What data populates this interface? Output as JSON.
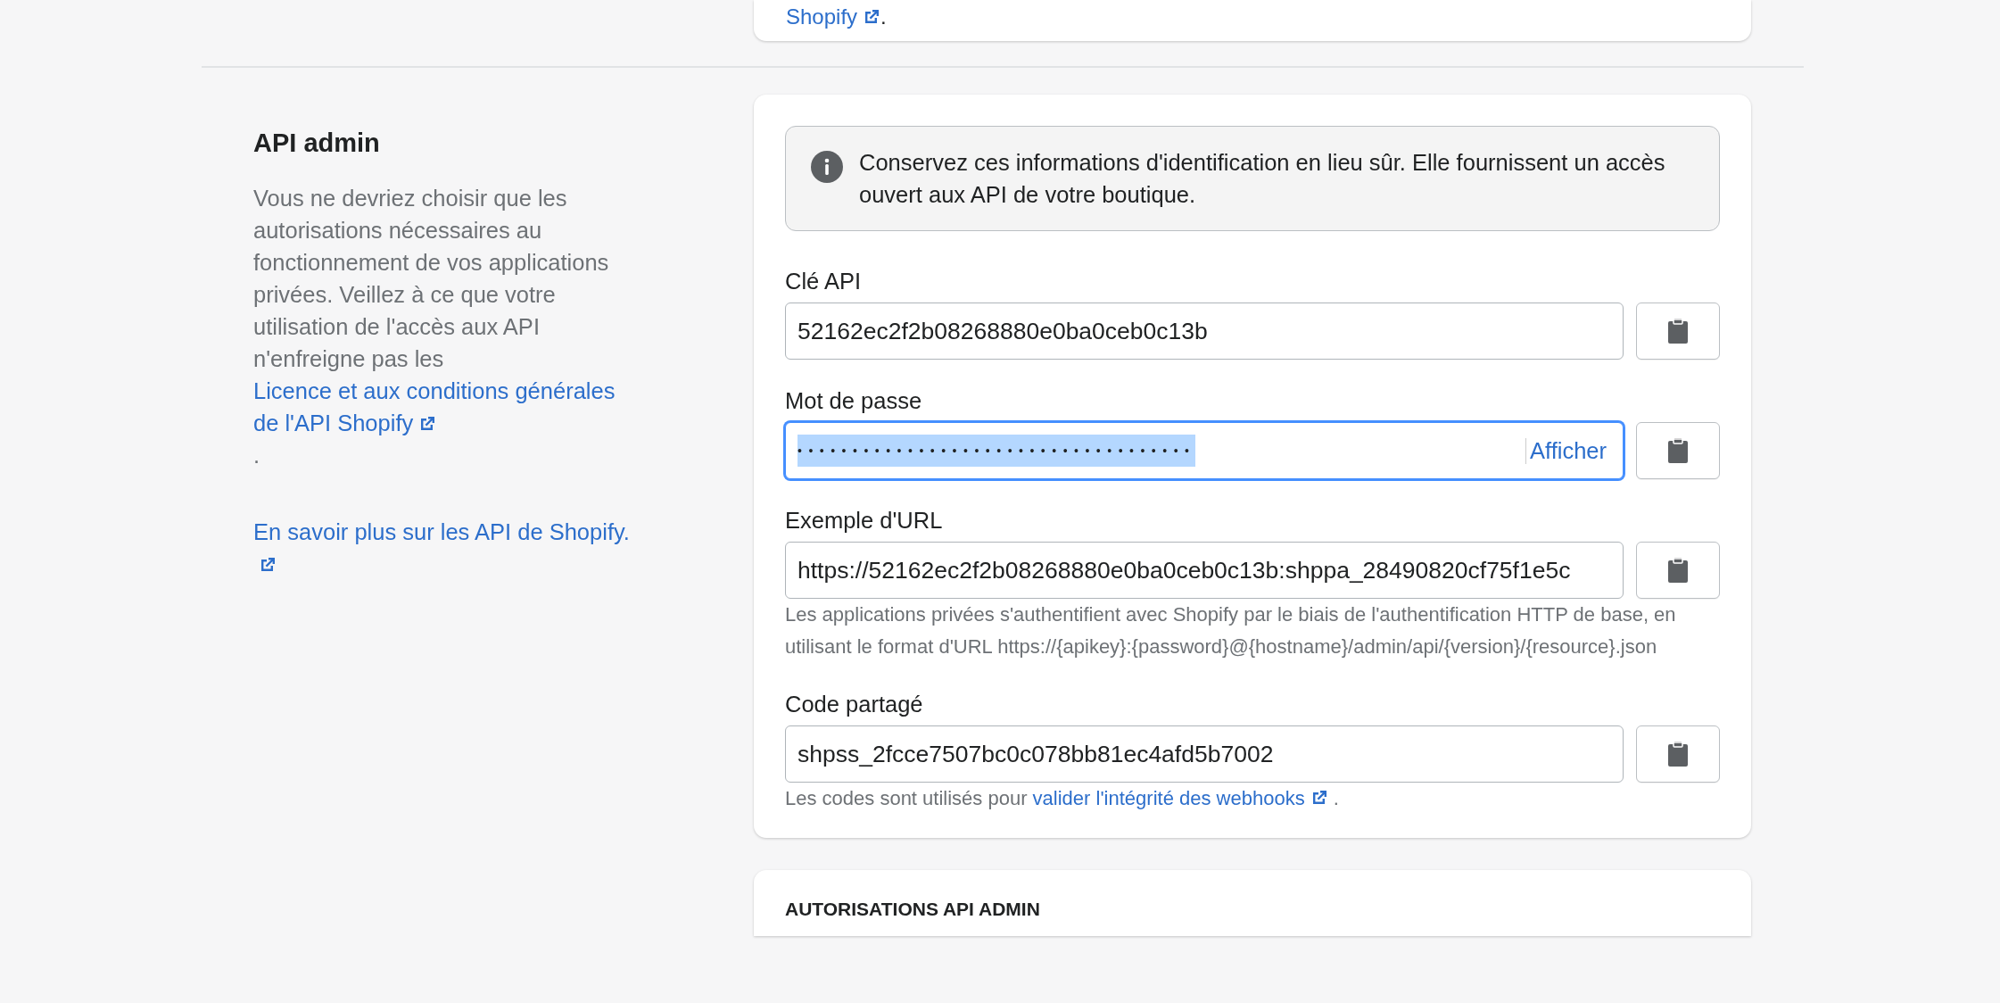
{
  "top_card": {
    "link": "Shopify",
    "after": "."
  },
  "section": {
    "title": "API admin",
    "description": {
      "text": "Vous ne devriez choisir que les autorisations nécessaires au fonctionnement de vos applications privées. Veillez à ce que votre utilisation de l'accès aux API n'enfreigne pas les",
      "link": "Licence et aux conditions générales de l'API Shopify",
      "after": "."
    },
    "learn_more": "En savoir plus sur les API de Shopify."
  },
  "credentials_card": {
    "banner": "Conservez ces informations d'identification en lieu sûr. Elle fournissent un accès ouvert aux API de votre boutique.",
    "fields": [
      {
        "kind": "text",
        "label": "Clé API",
        "value": "52162ec2f2b08268880e0ba0ceb0c13b",
        "focused": false
      },
      {
        "kind": "password",
        "label": "Mot de passe",
        "value": "••••••••••••••••••••••••••••••••••••",
        "focused": true,
        "value_selected": true,
        "reveal_label": "Afficher"
      },
      {
        "kind": "text",
        "label": "Exemple d'URL",
        "value": "https://52162ec2f2b08268880e0ba0ceb0c13b:shppa_28490820cf75f1e5c",
        "focused": false,
        "help": {
          "text": "Les applications privées s'authentifient avec Shopify par le biais de l'authentification HTTP de base, en utilisant le format d'URL https://{apikey}:{password}@{hostname}/admin/api/{version}/{resource}.json"
        }
      },
      {
        "kind": "text",
        "label": "Code partagé",
        "value": "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",
        "focused": false,
        "help": {
          "text": "Les codes sont utilisés pour",
          "link": "valider l'intégrité des webhooks",
          "after": "."
        }
      }
    ]
  },
  "permissions_card": {
    "title": "AUTORISATIONS API ADMIN"
  }
}
